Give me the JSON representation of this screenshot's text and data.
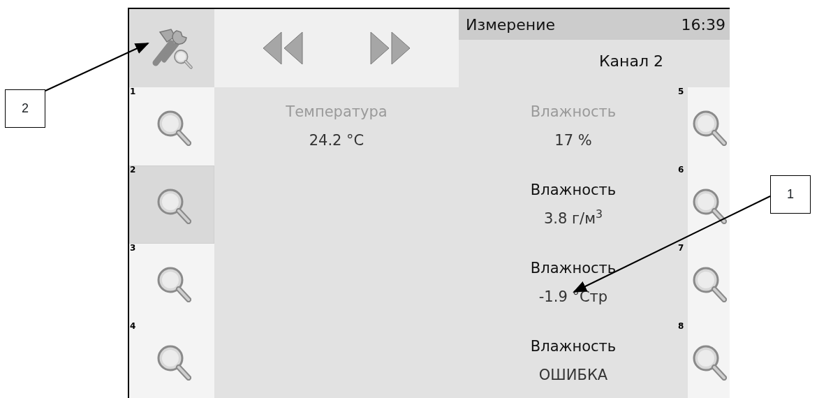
{
  "header": {
    "title": "Измерение",
    "time": "16:39",
    "channel": "Канал 2"
  },
  "left_slots": [
    {
      "number": "1",
      "selected": false
    },
    {
      "number": "2",
      "selected": true
    },
    {
      "number": "3",
      "selected": false
    },
    {
      "number": "4",
      "selected": false
    }
  ],
  "right_slots": [
    {
      "number": "5",
      "selected": false
    },
    {
      "number": "6",
      "selected": false
    },
    {
      "number": "7",
      "selected": false
    },
    {
      "number": "8",
      "selected": false
    }
  ],
  "readings_left": [
    {
      "title": "Температура",
      "value": "24.2 °C",
      "dimmed": true
    }
  ],
  "readings_right": [
    {
      "title": "Влажность",
      "value": "17 %",
      "dimmed": true
    },
    {
      "title": "Влажность",
      "value": "3.8 г/м$^{3}$",
      "dimmed": false
    },
    {
      "title": "Влажность",
      "value": "-1.9 °Стр",
      "dimmed": false
    },
    {
      "title": "Влажность",
      "value": "ОШИБКА",
      "dimmed": false
    }
  ],
  "callouts": [
    {
      "label": "2",
      "kind": "settings"
    },
    {
      "label": "1",
      "kind": "reading"
    }
  ]
}
